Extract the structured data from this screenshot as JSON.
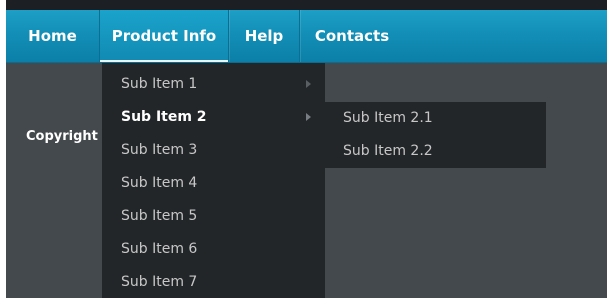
{
  "nav": {
    "items": [
      {
        "label": "Home"
      },
      {
        "label": "Product Info"
      },
      {
        "label": "Help"
      },
      {
        "label": "Contacts"
      }
    ],
    "active_item": "Product Info"
  },
  "footer": {
    "copyright_text": "Copyright"
  },
  "dropdown": {
    "items": [
      {
        "label": "Sub Item 1",
        "has_submenu": true
      },
      {
        "label": "Sub Item 2",
        "has_submenu": true
      },
      {
        "label": "Sub Item 3",
        "has_submenu": false
      },
      {
        "label": "Sub Item 4",
        "has_submenu": false
      },
      {
        "label": "Sub Item 5",
        "has_submenu": false
      },
      {
        "label": "Sub Item 6",
        "has_submenu": false
      },
      {
        "label": "Sub Item 7",
        "has_submenu": false
      }
    ],
    "active_item": "Sub Item 2",
    "submenu": {
      "items": [
        {
          "label": "Sub Item 2.1"
        },
        {
          "label": "Sub Item 2.2"
        }
      ]
    }
  },
  "colors": {
    "nav_background": "#138fb7",
    "page_background": "#44494d",
    "menu_background": "#232629",
    "menu_text": "#c7c7c7",
    "active_text": "#ffffff"
  },
  "icons": {
    "submenu_arrow": "chevron-right-icon"
  }
}
